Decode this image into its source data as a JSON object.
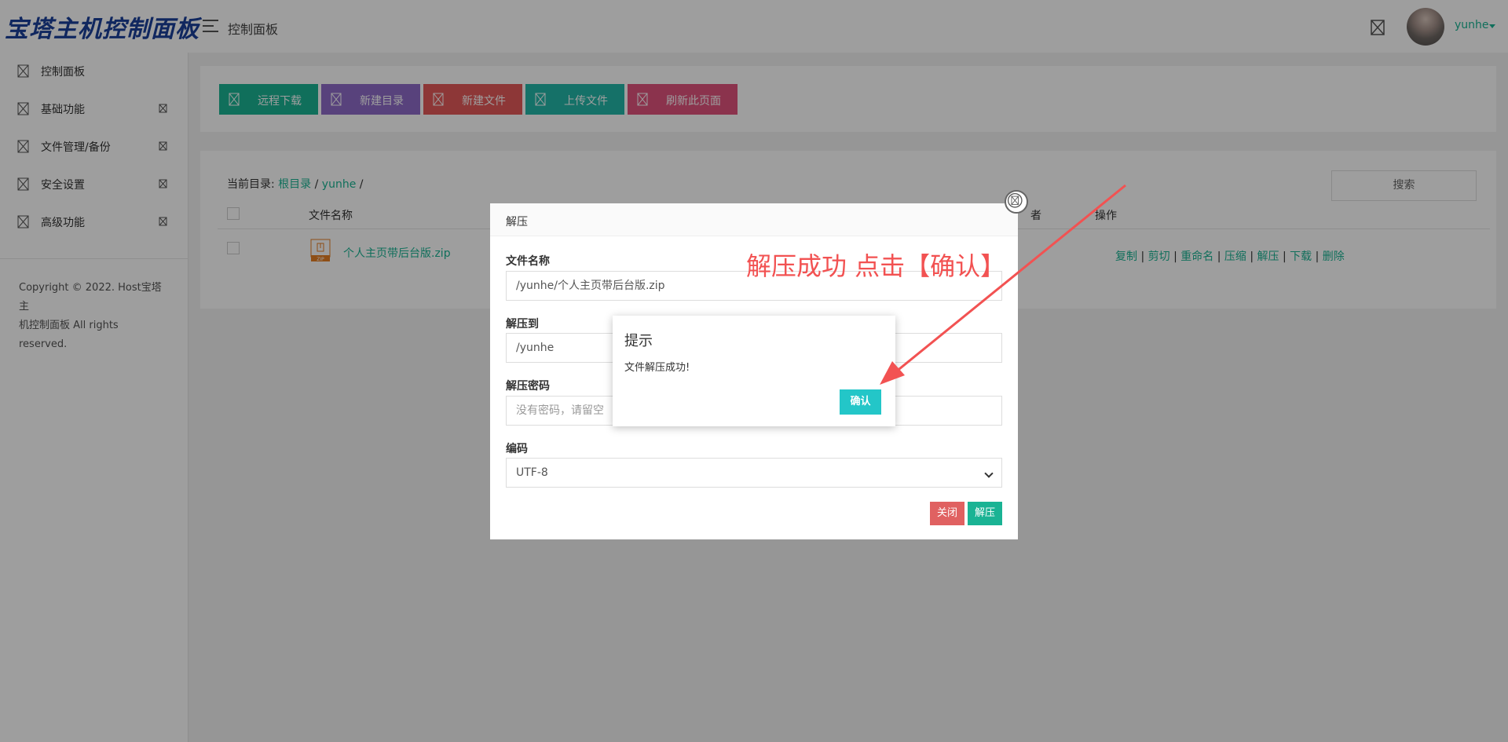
{
  "header": {
    "brand": "宝塔主机控制面板",
    "title": "控制面板",
    "user": "yunhe",
    "icon": "broken-image-icon"
  },
  "sidebar": {
    "items": [
      {
        "label": "控制面板",
        "has_arrow": false
      },
      {
        "label": "基础功能",
        "has_arrow": true
      },
      {
        "label": "文件管理/备份",
        "has_arrow": true
      },
      {
        "label": "安全设置",
        "has_arrow": true
      },
      {
        "label": "高级功能",
        "has_arrow": true
      }
    ],
    "copyright_line1": "Copyright © 2022. Host宝塔主",
    "copyright_line2": "机控制面板 All rights reserved."
  },
  "toolbar": {
    "buttons": [
      {
        "label": "远程下载",
        "color": "#1ab394"
      },
      {
        "label": "新建目录",
        "color": "#8e6bc8"
      },
      {
        "label": "新建文件",
        "color": "#e45a5a"
      },
      {
        "label": "上传文件",
        "color": "#23b7a8"
      },
      {
        "label": "刷新此页面",
        "color": "#e0537d"
      }
    ]
  },
  "files": {
    "crumb_label": "当前目录:",
    "crumb_root": "根目录",
    "crumb_sep": "/",
    "crumb_dir": "yunhe",
    "crumb_end": "/",
    "search_label": "搜索",
    "columns": {
      "name": "文件名称",
      "owner_fragment": "者",
      "ops": "操作"
    },
    "rows": [
      {
        "name": "个人主页带后台版.zip",
        "type_badge": "ZIP"
      }
    ],
    "operations": [
      "复制",
      "剪切",
      "重命名",
      "压缩",
      "解压",
      "下载",
      "删除"
    ],
    "op_sep": "|"
  },
  "extract_dialog": {
    "title": "解压",
    "filename_label": "文件名称",
    "filename_value": "/yunhe/个人主页带后台版.zip",
    "target_label": "解压到",
    "target_value": "/yunhe",
    "password_label": "解压密码",
    "password_placeholder": "没有密码，请留空",
    "encoding_label": "编码",
    "encoding_value": "UTF-8",
    "close_label": "关闭",
    "extract_label": "解压"
  },
  "prompt": {
    "title": "提示",
    "message": "文件解压成功!",
    "confirm_label": "确认"
  },
  "annotation": {
    "text": "解压成功 点击【确认】",
    "color": "#f25252"
  },
  "colors": {
    "accent": "#1ab394",
    "brand": "#1a3f9a",
    "confirm": "#23c6c8",
    "danger": "#e06161"
  }
}
